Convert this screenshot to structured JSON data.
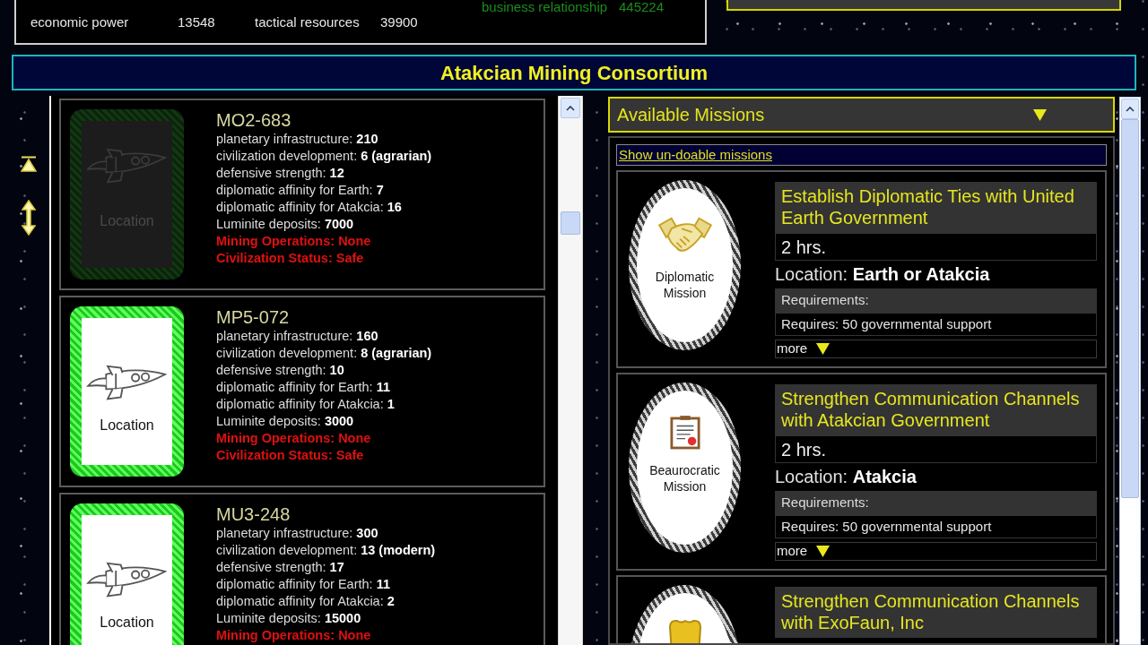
{
  "stats_panel": {
    "stats": [
      {
        "label": "economic power",
        "value": "13548"
      },
      {
        "label": "tactical resources",
        "value": "39900"
      }
    ],
    "relationship": {
      "label": "business relationship",
      "value": "445224"
    }
  },
  "header": {
    "title": "Atakcian Mining Consortium"
  },
  "locations": [
    {
      "name": "MO2-683",
      "available": false,
      "image_label": "Location",
      "attributes": [
        "planetary infrastructure: **210**",
        "civilization development: **6 (agrarian)**",
        "defensive strength: **12**",
        "diplomatic affinity for Earth: **7**",
        "diplomatic affinity for Atakcia: **16**",
        "Luminite deposits: **7000**"
      ],
      "alerts": [
        "Mining Operations: None",
        "Civilization Status: Safe"
      ]
    },
    {
      "name": "MP5-072",
      "available": true,
      "image_label": "Location",
      "attributes": [
        "planetary infrastructure: **160**",
        "civilization development: **8 (agrarian)**",
        "defensive strength: **10**",
        "diplomatic affinity for Earth: **11**",
        "diplomatic affinity for Atakcia: **1**",
        "Luminite deposits: **3000**"
      ],
      "alerts": [
        "Mining Operations: None",
        "Civilization Status: Safe"
      ]
    },
    {
      "name": "MU3-248",
      "available": true,
      "image_label": "Location",
      "attributes": [
        "planetary infrastructure: **300**",
        "civilization development: **13 (modern)**",
        "defensive strength: **17**",
        "diplomatic affinity for Earth: **11**",
        "diplomatic affinity for Atakcia: **2**",
        "Luminite deposits: **15000**"
      ],
      "alerts": [
        "Mining Operations: None"
      ]
    }
  ],
  "missions": {
    "title": "Available Missions",
    "toggle_link": "Show un-doable missions",
    "items": [
      {
        "kind": "diplomatic",
        "badge_label": "Diplomatic Mission",
        "title": "Establish Diplomatic Ties with United Earth Government",
        "duration": "2 hrs.",
        "location": "Location: **Earth or Atakcia**",
        "requirements_title": "Requirements:",
        "requirements": [
          "Requires: 50 governmental support"
        ],
        "more": "more"
      },
      {
        "kind": "bureaucratic",
        "badge_label": "Beaurocratic Mission",
        "title": "Strengthen Communication Channels with Atakcian Government",
        "duration": "2 hrs.",
        "location": "Location: **Atakcia**",
        "requirements_title": "Requirements:",
        "requirements": [
          "Requires: 50 governmental support"
        ],
        "more": "more"
      },
      {
        "kind": "corporate",
        "title": "Strengthen Communication Channels with ExoFaun, Inc"
      }
    ]
  }
}
